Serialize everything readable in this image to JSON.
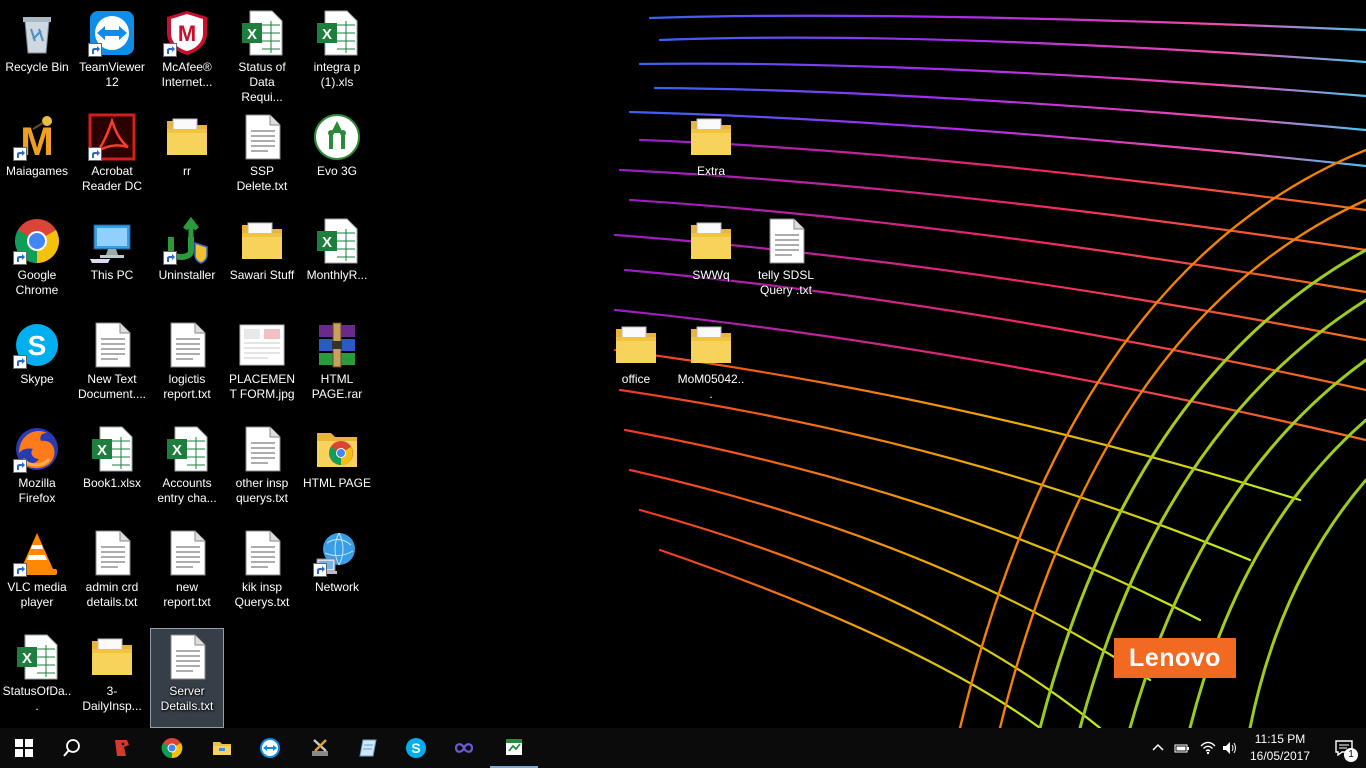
{
  "desktop": {
    "icons": [
      {
        "label": "Recycle Bin",
        "icon": "recycle-bin-icon"
      },
      {
        "label": "TeamViewer 12",
        "icon": "teamviewer-icon"
      },
      {
        "label": "McAfee® Internet...",
        "icon": "mcafee-icon"
      },
      {
        "label": "Status of Data Requi...",
        "icon": "excel-icon"
      },
      {
        "label": "integra p (1).xls",
        "icon": "excel-icon"
      },
      {
        "label": "Maiagames",
        "icon": "maiagames-icon"
      },
      {
        "label": "Acrobat Reader DC",
        "icon": "acrobat-icon"
      },
      {
        "label": "rr",
        "icon": "folder-icon"
      },
      {
        "label": "SSP Delete.txt",
        "icon": "text-file-icon"
      },
      {
        "label": "Evo 3G",
        "icon": "evo-3g-icon"
      },
      {
        "label": "Google Chrome",
        "icon": "chrome-icon"
      },
      {
        "label": "This PC",
        "icon": "computer-icon"
      },
      {
        "label": "Uninstaller",
        "icon": "uninstaller-icon"
      },
      {
        "label": "Sawari Stuff",
        "icon": "folder-icon"
      },
      {
        "label": "MonthlyR...",
        "icon": "excel-icon"
      },
      {
        "label": "Skype",
        "icon": "skype-icon"
      },
      {
        "label": "New Text Document....",
        "icon": "text-file-icon"
      },
      {
        "label": "logictis report.txt",
        "icon": "text-file-icon"
      },
      {
        "label": "PLACEMENT FORM.jpg",
        "icon": "image-file-icon"
      },
      {
        "label": "HTML PAGE.rar",
        "icon": "winrar-icon"
      },
      {
        "label": "Mozilla Firefox",
        "icon": "firefox-icon"
      },
      {
        "label": "Book1.xlsx",
        "icon": "excel-icon"
      },
      {
        "label": "Accounts entry cha...",
        "icon": "excel-icon"
      },
      {
        "label": "other insp querys.txt",
        "icon": "text-file-icon"
      },
      {
        "label": "HTML PAGE",
        "icon": "chrome-folder-icon"
      },
      {
        "label": "VLC media player",
        "icon": "vlc-icon"
      },
      {
        "label": "admin crd details.txt",
        "icon": "text-file-icon"
      },
      {
        "label": "new report.txt",
        "icon": "text-file-icon"
      },
      {
        "label": "kik insp Querys.txt",
        "icon": "text-file-icon"
      },
      {
        "label": "Network",
        "icon": "network-icon"
      },
      {
        "label": "StatusOfDa...",
        "icon": "excel-icon"
      },
      {
        "label": "3-DailyInsp...",
        "icon": "folder-icon"
      },
      {
        "label": "Server Details.txt",
        "icon": "text-file-icon",
        "selected": true
      },
      {
        "label": "Extra",
        "icon": "folder-icon"
      },
      {
        "label": "SWWq",
        "icon": "folder-icon"
      },
      {
        "label": "telly SDSL Query .txt",
        "icon": "text-file-icon"
      },
      {
        "label": "office",
        "icon": "folder-icon"
      },
      {
        "label": "MoM05042...",
        "icon": "folder-icon"
      }
    ],
    "logo": "Lenovo"
  },
  "taskbar": {
    "buttons": [
      {
        "name": "start-button",
        "icon": "windows-logo-icon"
      },
      {
        "name": "search-button",
        "icon": "search-icon"
      },
      {
        "name": "taskbar-app-red",
        "icon": "red-app-icon"
      },
      {
        "name": "taskbar-chrome",
        "icon": "chrome-icon"
      },
      {
        "name": "taskbar-file-explorer",
        "icon": "folder-icon"
      },
      {
        "name": "taskbar-teamviewer",
        "icon": "teamviewer-icon"
      },
      {
        "name": "taskbar-tools",
        "icon": "tools-icon"
      },
      {
        "name": "taskbar-notes",
        "icon": "notes-icon"
      },
      {
        "name": "taskbar-skype",
        "icon": "skype-icon"
      },
      {
        "name": "taskbar-infinity",
        "icon": "infinity-icon"
      },
      {
        "name": "taskbar-excel-sheet",
        "icon": "spreadsheet-icon"
      }
    ],
    "tray": {
      "icons": [
        "chevron-up-icon",
        "battery-icon",
        "wifi-icon",
        "volume-icon"
      ]
    },
    "clock": {
      "time": "11:15 PM",
      "date": "16/05/2017"
    },
    "notifications": {
      "count": "1"
    },
    "accent": "#7aa7d8"
  }
}
